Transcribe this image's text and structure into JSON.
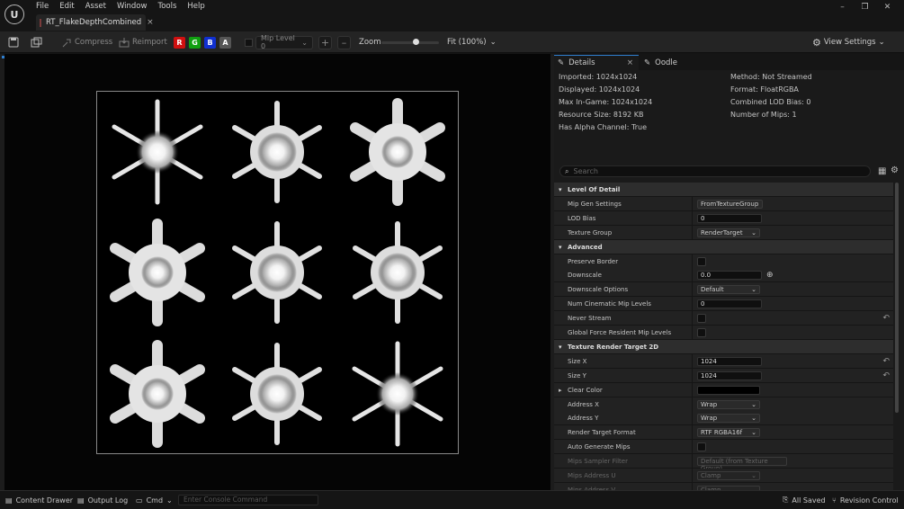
{
  "app": {
    "logo": "U"
  },
  "menu": [
    "File",
    "Edit",
    "Asset",
    "Window",
    "Tools",
    "Help"
  ],
  "tab": {
    "title": "RT_FlakeDepthCombined",
    "close": "×"
  },
  "window_controls": [
    "–",
    "❐",
    "✕"
  ],
  "toolbar": {
    "compress": "Compress",
    "reimport": "Reimport",
    "r": "R",
    "g": "G",
    "b": "B",
    "a": "A",
    "mip": "Mip Level 0",
    "zoom_label": "Zoom",
    "zoom_value": "Fit (100%)",
    "view_settings": "View Settings",
    "zoom_level": 0.6
  },
  "details": {
    "tab_details": "Details",
    "tab_oodle": "Oodle",
    "info_left": [
      "Imported: 1024x1024",
      "Displayed: 1024x1024",
      "Max In-Game: 1024x1024",
      "Resource Size: 8192 KB",
      "Has Alpha Channel: True"
    ],
    "info_right": [
      "Method: Not Streamed",
      "Format: FloatRGBA",
      "Combined LOD Bias: 0",
      "Number of Mips: 1"
    ],
    "search_placeholder": "Search",
    "rows": [
      {
        "type": "cat",
        "label": "Level Of Detail"
      },
      {
        "type": "dd",
        "label": "Mip Gen Settings",
        "value": "FromTextureGroup"
      },
      {
        "type": "box",
        "label": "LOD Bias",
        "value": "0"
      },
      {
        "type": "dd",
        "label": "Texture Group",
        "value": "RenderTarget"
      },
      {
        "type": "cat",
        "label": "Advanced"
      },
      {
        "type": "chk",
        "label": "Preserve Border"
      },
      {
        "type": "box",
        "label": "Downscale",
        "value": "0.0",
        "extra": "⊕"
      },
      {
        "type": "dd",
        "label": "Downscale Options",
        "value": "Default"
      },
      {
        "type": "box",
        "label": "Num Cinematic Mip Levels",
        "value": "0"
      },
      {
        "type": "chk",
        "label": "Never Stream",
        "reset": "↶"
      },
      {
        "type": "chk",
        "label": "Global Force Resident Mip Levels"
      },
      {
        "type": "cat",
        "label": "Texture Render Target 2D"
      },
      {
        "type": "box",
        "label": "Size X",
        "value": "1024",
        "reset": "↶"
      },
      {
        "type": "box",
        "label": "Size Y",
        "value": "1024",
        "reset": "↶"
      },
      {
        "type": "color",
        "label": "Clear Color"
      },
      {
        "type": "dd",
        "label": "Address X",
        "value": "Wrap"
      },
      {
        "type": "dd",
        "label": "Address Y",
        "value": "Wrap"
      },
      {
        "type": "dd",
        "label": "Render Target Format",
        "value": "RTF RGBA16f"
      },
      {
        "type": "chk",
        "label": "Auto Generate Mips"
      },
      {
        "type": "dd",
        "label": "Mips Sampler Filter",
        "value": "Default (from Texture Group)",
        "dim": true
      },
      {
        "type": "dd",
        "label": "Mips Address U",
        "value": "Clamp",
        "dim": true
      },
      {
        "type": "dd",
        "label": "Mips Address V",
        "value": "Clamp",
        "dim": true
      }
    ]
  },
  "status": {
    "content_drawer": "Content Drawer",
    "output_log": "Output Log",
    "cmd": "Cmd",
    "console_placeholder": "Enter Console Command",
    "all_saved": "All Saved",
    "revision_control": "Revision Control"
  },
  "colors": {
    "red": "#d01010",
    "green": "#10a010",
    "blue": "#1030d0",
    "alpha": "#555555"
  }
}
